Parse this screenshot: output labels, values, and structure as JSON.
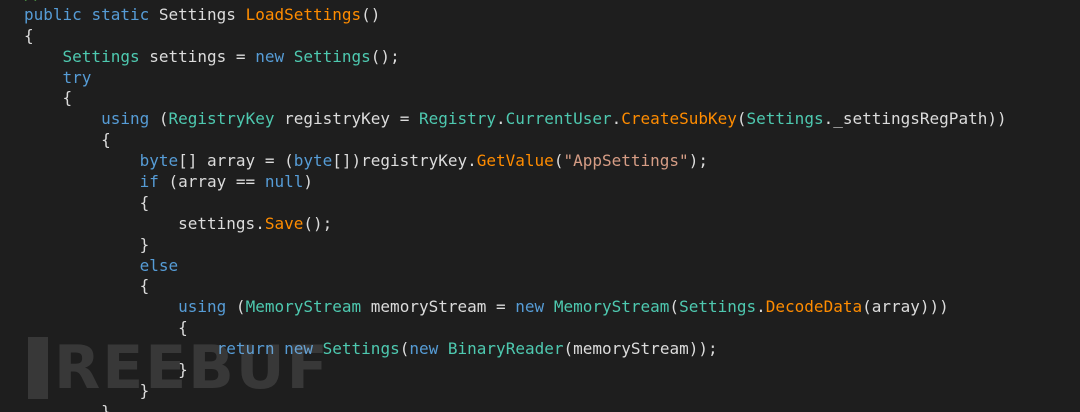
{
  "editor": {
    "colors": {
      "background": "#1e1e1e",
      "keyword": "#569cd6",
      "type": "#4ec9b0",
      "method": "#ff8c00",
      "string": "#d69d85",
      "text": "#dcdcdc"
    },
    "lines": [
      [
        {
          "t": "//",
          "c": "comment"
        }
      ],
      [
        {
          "t": "public",
          "c": "kw"
        },
        {
          "t": " ",
          "c": "punc"
        },
        {
          "t": "static",
          "c": "kw"
        },
        {
          "t": " Settings ",
          "c": "ident"
        },
        {
          "t": "LoadSettings",
          "c": "method"
        },
        {
          "t": "()",
          "c": "punc"
        }
      ],
      [
        {
          "t": "{",
          "c": "punc"
        }
      ],
      [
        {
          "t": "    ",
          "c": "punc"
        },
        {
          "t": "Settings",
          "c": "type"
        },
        {
          "t": " settings = ",
          "c": "ident"
        },
        {
          "t": "new",
          "c": "kw"
        },
        {
          "t": " ",
          "c": "punc"
        },
        {
          "t": "Settings",
          "c": "type"
        },
        {
          "t": "();",
          "c": "punc"
        }
      ],
      [
        {
          "t": "    ",
          "c": "punc"
        },
        {
          "t": "try",
          "c": "kw"
        }
      ],
      [
        {
          "t": "    {",
          "c": "punc"
        }
      ],
      [
        {
          "t": "        ",
          "c": "punc"
        },
        {
          "t": "using",
          "c": "kw"
        },
        {
          "t": " (",
          "c": "punc"
        },
        {
          "t": "RegistryKey",
          "c": "type"
        },
        {
          "t": " registryKey = ",
          "c": "ident"
        },
        {
          "t": "Registry",
          "c": "type"
        },
        {
          "t": ".",
          "c": "punc"
        },
        {
          "t": "CurrentUser",
          "c": "type"
        },
        {
          "t": ".",
          "c": "punc"
        },
        {
          "t": "CreateSubKey",
          "c": "method"
        },
        {
          "t": "(",
          "c": "punc"
        },
        {
          "t": "Settings",
          "c": "type"
        },
        {
          "t": "._settingsRegPath))",
          "c": "ident"
        }
      ],
      [
        {
          "t": "        {",
          "c": "punc"
        }
      ],
      [
        {
          "t": "            ",
          "c": "punc"
        },
        {
          "t": "byte",
          "c": "kw"
        },
        {
          "t": "[] array = (",
          "c": "ident"
        },
        {
          "t": "byte",
          "c": "kw"
        },
        {
          "t": "[])registryKey.",
          "c": "ident"
        },
        {
          "t": "GetValue",
          "c": "method"
        },
        {
          "t": "(",
          "c": "punc"
        },
        {
          "t": "\"AppSettings\"",
          "c": "str"
        },
        {
          "t": ");",
          "c": "punc"
        }
      ],
      [
        {
          "t": "            ",
          "c": "punc"
        },
        {
          "t": "if",
          "c": "kw"
        },
        {
          "t": " (array == ",
          "c": "ident"
        },
        {
          "t": "null",
          "c": "kw"
        },
        {
          "t": ")",
          "c": "punc"
        }
      ],
      [
        {
          "t": "            {",
          "c": "punc"
        }
      ],
      [
        {
          "t": "                settings.",
          "c": "ident"
        },
        {
          "t": "Save",
          "c": "method"
        },
        {
          "t": "();",
          "c": "punc"
        }
      ],
      [
        {
          "t": "            }",
          "c": "punc"
        }
      ],
      [
        {
          "t": "            ",
          "c": "punc"
        },
        {
          "t": "else",
          "c": "kw"
        }
      ],
      [
        {
          "t": "            {",
          "c": "punc"
        }
      ],
      [
        {
          "t": "                ",
          "c": "punc"
        },
        {
          "t": "using",
          "c": "kw"
        },
        {
          "t": " (",
          "c": "punc"
        },
        {
          "t": "MemoryStream",
          "c": "type"
        },
        {
          "t": " memoryStream = ",
          "c": "ident"
        },
        {
          "t": "new",
          "c": "kw"
        },
        {
          "t": " ",
          "c": "punc"
        },
        {
          "t": "MemoryStream",
          "c": "type"
        },
        {
          "t": "(",
          "c": "punc"
        },
        {
          "t": "Settings",
          "c": "type"
        },
        {
          "t": ".",
          "c": "punc"
        },
        {
          "t": "DecodeData",
          "c": "method"
        },
        {
          "t": "(array)))",
          "c": "ident"
        }
      ],
      [
        {
          "t": "                {",
          "c": "punc"
        }
      ],
      [
        {
          "t": "                    ",
          "c": "punc"
        },
        {
          "t": "return",
          "c": "kw"
        },
        {
          "t": " ",
          "c": "punc"
        },
        {
          "t": "new",
          "c": "kw"
        },
        {
          "t": " ",
          "c": "punc"
        },
        {
          "t": "Settings",
          "c": "type"
        },
        {
          "t": "(",
          "c": "punc"
        },
        {
          "t": "new",
          "c": "kw"
        },
        {
          "t": " ",
          "c": "punc"
        },
        {
          "t": "BinaryReader",
          "c": "type"
        },
        {
          "t": "(memoryStream));",
          "c": "ident"
        }
      ],
      [
        {
          "t": "                }",
          "c": "punc"
        }
      ],
      [
        {
          "t": "            }",
          "c": "punc"
        }
      ],
      [
        {
          "t": "        }",
          "c": "punc"
        }
      ]
    ]
  },
  "watermark": {
    "text": "REEBUF"
  }
}
